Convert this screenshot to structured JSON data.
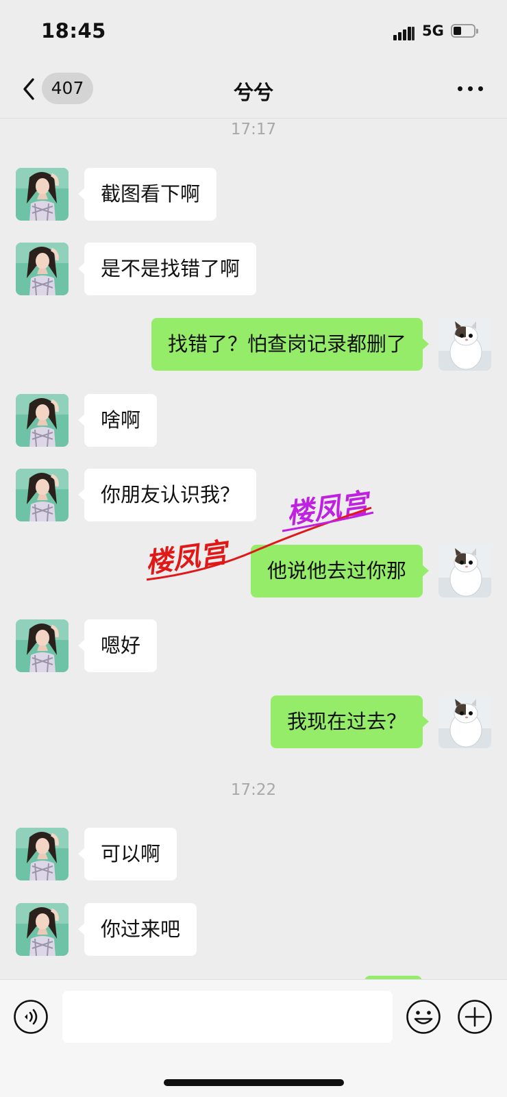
{
  "status_bar": {
    "time": "18:45",
    "network": "5G"
  },
  "nav": {
    "unread_count": "407",
    "title": "兮兮"
  },
  "chat": {
    "timestamps": [
      "17:17",
      "17:22"
    ],
    "messages": [
      {
        "side": "in",
        "text": "截图看下啊"
      },
      {
        "side": "in",
        "text": "是不是找错了啊"
      },
      {
        "side": "out",
        "text": "找错了？怕查岗记录都删了"
      },
      {
        "side": "in",
        "text": "啥啊"
      },
      {
        "side": "in",
        "text": "你朋友认识我？"
      },
      {
        "side": "out",
        "text": "他说他去过你那"
      },
      {
        "side": "in",
        "text": "嗯好"
      },
      {
        "side": "out",
        "text": "我现在过去？"
      },
      {
        "side": "in",
        "text": "可以啊"
      },
      {
        "side": "in",
        "text": "你过来吧"
      }
    ]
  },
  "watermarks": [
    {
      "text": "楼凤宫",
      "color": "#e01818"
    },
    {
      "text": "楼凤宫",
      "color": "#c020e0"
    }
  ],
  "input_bar": {
    "message_value": ""
  },
  "icons": {
    "back": "chevron-left-icon",
    "more": "more-dots-icon",
    "voice": "voice-icon",
    "emoji": "emoji-icon",
    "plus": "plus-icon"
  },
  "colors": {
    "background": "#ededed",
    "outgoing_bubble": "#95ec69",
    "incoming_bubble": "#ffffff"
  }
}
